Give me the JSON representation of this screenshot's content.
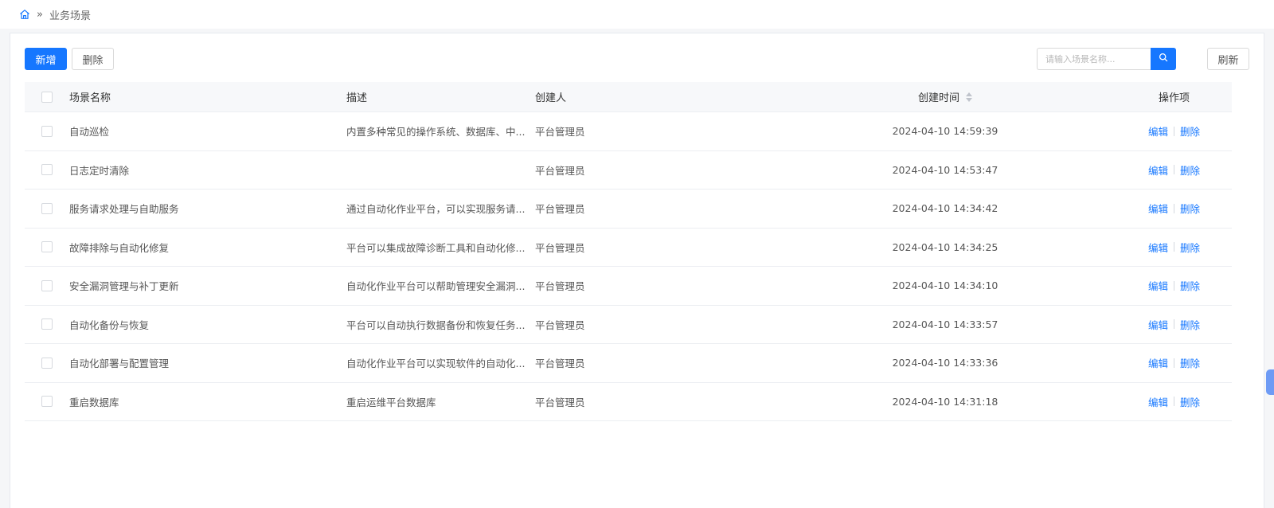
{
  "breadcrumb": {
    "separator": "»",
    "current": "业务场景"
  },
  "toolbar": {
    "add_label": "新增",
    "delete_label": "删除",
    "search_placeholder": "请输入场景名称...",
    "refresh_label": "刷新"
  },
  "table": {
    "columns": {
      "name": "场景名称",
      "desc": "描述",
      "creator": "创建人",
      "time": "创建时间",
      "ops": "操作项"
    },
    "edit_label": "编辑",
    "delete_label": "删除",
    "rows": [
      {
        "name": "自动巡检",
        "desc": "内置多种常见的操作系统、数据库、中...",
        "creator": "平台管理员",
        "time": "2024-04-10 14:59:39"
      },
      {
        "name": "日志定时清除",
        "desc": "",
        "creator": "平台管理员",
        "time": "2024-04-10 14:53:47"
      },
      {
        "name": "服务请求处理与自助服务",
        "desc": "通过自动化作业平台，可以实现服务请...",
        "creator": "平台管理员",
        "time": "2024-04-10 14:34:42"
      },
      {
        "name": "故障排除与自动化修复",
        "desc": "平台可以集成故障诊断工具和自动化修...",
        "creator": "平台管理员",
        "time": "2024-04-10 14:34:25"
      },
      {
        "name": "安全漏洞管理与补丁更新",
        "desc": "自动化作业平台可以帮助管理安全漏洞...",
        "creator": "平台管理员",
        "time": "2024-04-10 14:34:10"
      },
      {
        "name": "自动化备份与恢复",
        "desc": "平台可以自动执行数据备份和恢复任务...",
        "creator": "平台管理员",
        "time": "2024-04-10 14:33:57"
      },
      {
        "name": "自动化部署与配置管理",
        "desc": "自动化作业平台可以实现软件的自动化...",
        "creator": "平台管理员",
        "time": "2024-04-10 14:33:36"
      },
      {
        "name": "重启数据库",
        "desc": "重启运维平台数据库",
        "creator": "平台管理员",
        "time": "2024-04-10 14:31:18"
      }
    ]
  },
  "colors": {
    "primary": "#1677ff",
    "side_tab": "#6e9bf5"
  }
}
